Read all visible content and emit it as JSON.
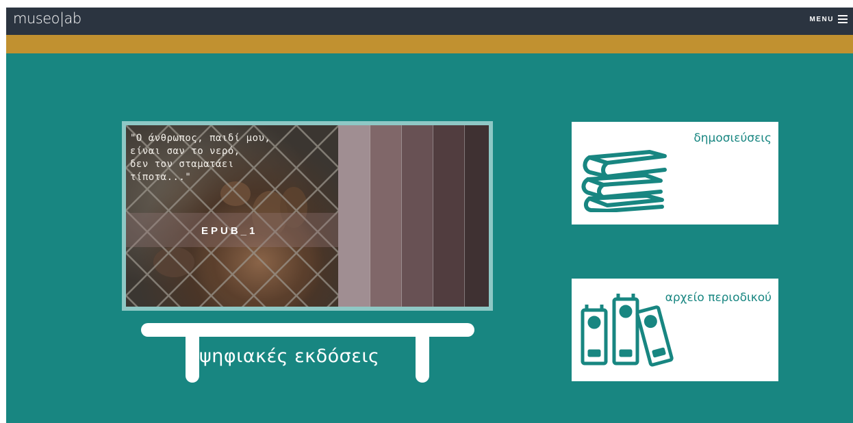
{
  "header": {
    "logo": "museo|ab",
    "menu_label": "MENU"
  },
  "colors": {
    "topbar": "#2b3440",
    "stripe": "#c19130",
    "background": "#188681",
    "accent": "#188681"
  },
  "feature": {
    "quote": "\"Ο άνθρωπος, παιδί μου,\nείναι σαν το νερό,\nδεν τον σταματάει\nτίποτα...\"",
    "label": "EPUB_1",
    "swatches": [
      "#a08e92",
      "#806769",
      "#685154",
      "#513d3f",
      "#3f3132"
    ]
  },
  "bench": {
    "label": "ψηφιακές εκδόσεις"
  },
  "cards": [
    {
      "title": "δημοσιεύσεις",
      "icon": "books-icon"
    },
    {
      "title": "αρχείο περιοδικού",
      "icon": "binders-icon"
    }
  ]
}
